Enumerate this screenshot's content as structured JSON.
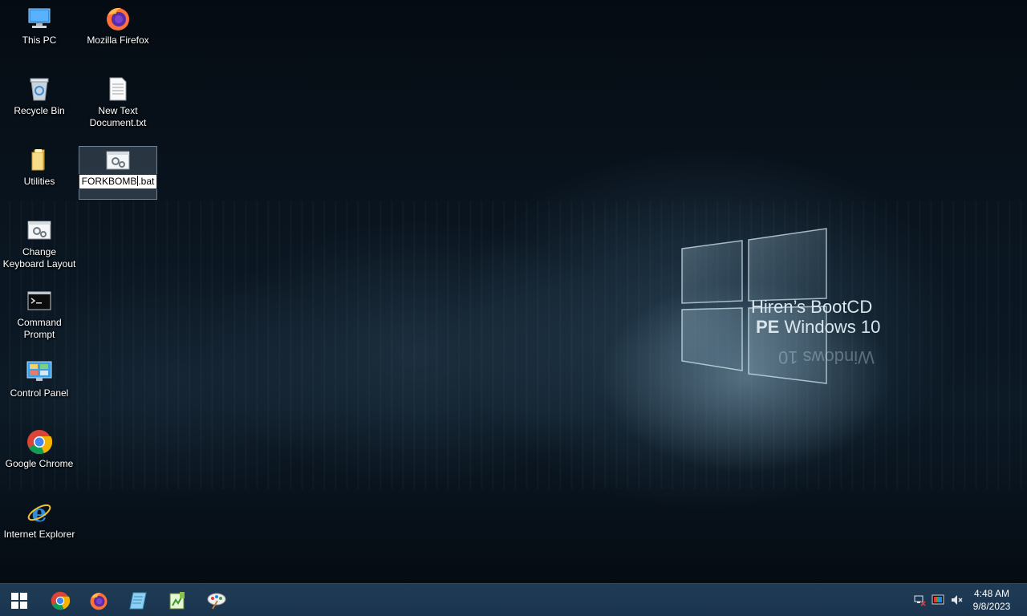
{
  "desktop": {
    "icons": [
      {
        "label": "This PC"
      },
      {
        "label": "Mozilla Firefox"
      },
      {
        "label": "Recycle Bin"
      },
      {
        "label": "New Text Document.txt"
      },
      {
        "label": "Utilities"
      },
      {
        "label": "FORKBOMB.bat",
        "rename_before": "FORKBOMB",
        "rename_after": ".bat"
      },
      {
        "label": "Change Keyboard Layout"
      },
      {
        "label": "Command Prompt"
      },
      {
        "label": "Control Panel"
      },
      {
        "label": "Google Chrome"
      },
      {
        "label": "Internet Explorer"
      }
    ]
  },
  "wallpaper": {
    "line1": "Hiren’s BootCD",
    "line2_bold": "PE",
    "line2_rest": " Windows 10",
    "reflection": "Windows 10"
  },
  "taskbar": {
    "start": "start-icon",
    "pinned": [
      "chrome-icon",
      "firefox-icon",
      "notepad-icon",
      "notepad-plus-icon",
      "paint-icon"
    ],
    "tray": [
      "network-icon",
      "color-icon",
      "volume-muted-icon"
    ],
    "clock": {
      "time": "4:48 AM",
      "date": "9/8/2023"
    }
  },
  "colors": {
    "taskbar": "#1b3550",
    "desktop_bg": "#06101a",
    "selection": "#5a7084"
  }
}
